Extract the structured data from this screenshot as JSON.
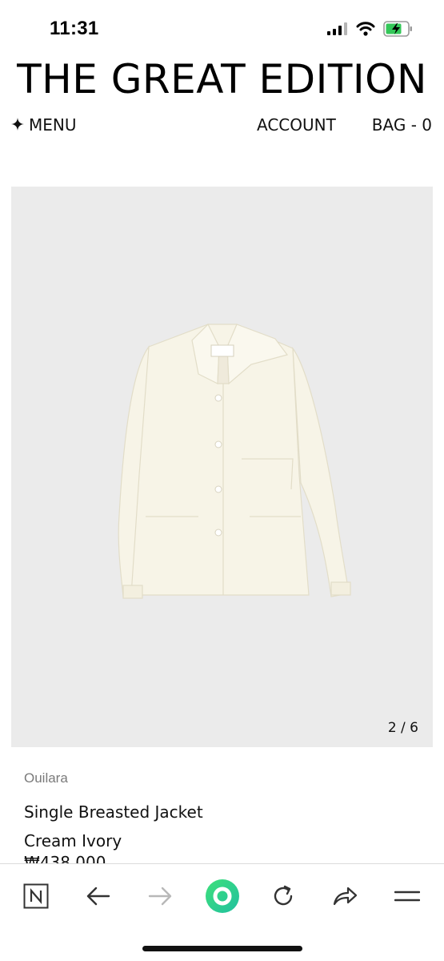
{
  "status_bar": {
    "time": "11:31",
    "icons": [
      "signal-icon",
      "wifi-icon",
      "battery-charging-icon"
    ]
  },
  "header": {
    "brand": "THE GREAT EDITION",
    "menu_icon": "sparkle-star-icon",
    "menu_label": "MENU",
    "account_label": "ACCOUNT",
    "bag_label": "BAG - 0"
  },
  "gallery": {
    "counter": "2 / 6",
    "image": "cream-jacket-product-photo"
  },
  "product": {
    "brand": "Ouilara",
    "name": "Single Breasted Jacket",
    "color": "Cream Ivory",
    "price": "₩438,000"
  },
  "toolbar": {
    "buttons": [
      "naver-n-icon",
      "back-arrow-icon",
      "forward-arrow-icon",
      "green-dot-icon",
      "reload-icon",
      "share-icon",
      "hamburger-menu-icon"
    ],
    "accent_color": "#2ecc71"
  }
}
